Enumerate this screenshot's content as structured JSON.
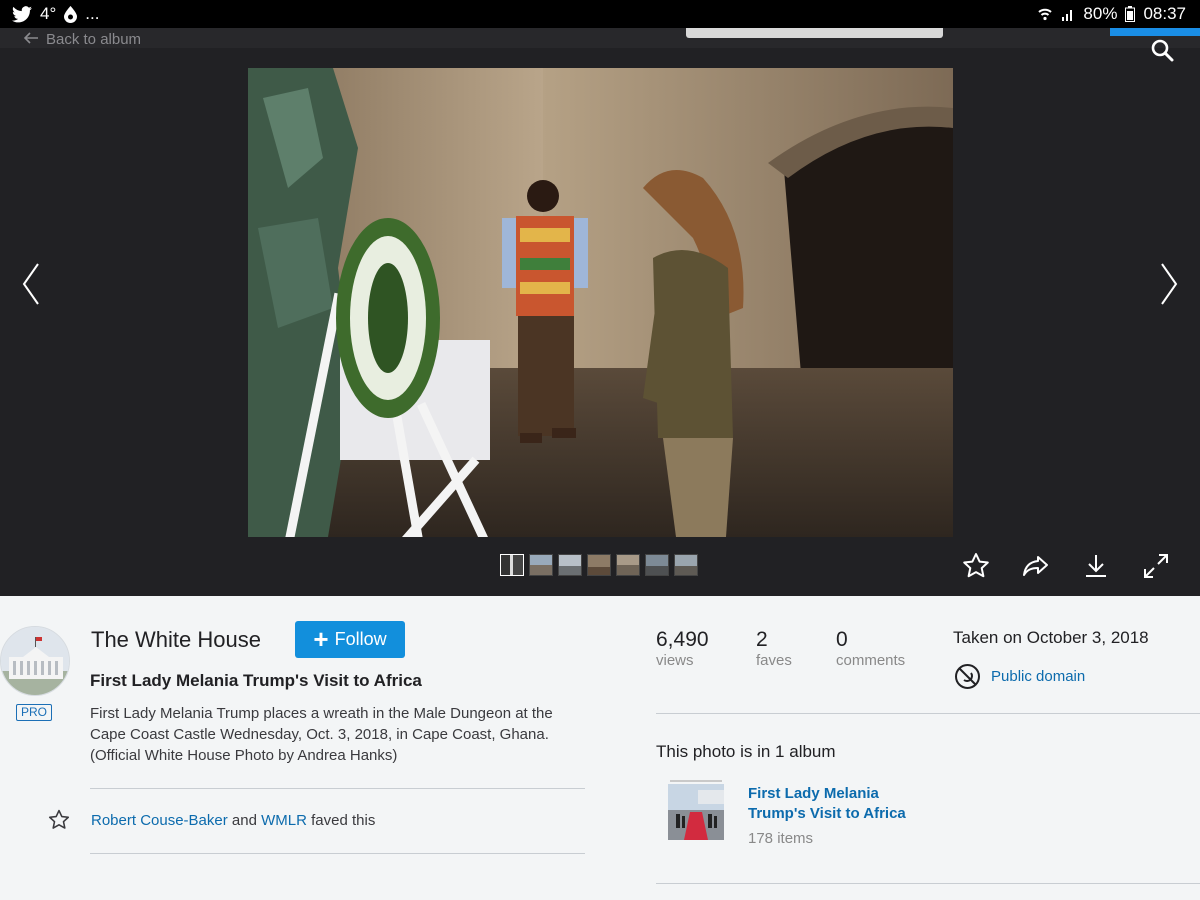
{
  "statusbar": {
    "temperature": "4°",
    "more": "...",
    "battery": "80%",
    "time": "08:37"
  },
  "viewer": {
    "back_label": "Back to album",
    "thumbnail_count": 7,
    "active_thumbnail": 1
  },
  "owner": {
    "name": "The White House",
    "badge": "PRO",
    "follow_label": "Follow"
  },
  "photo": {
    "title": "First Lady Melania Trump's Visit to Africa",
    "description": "First Lady Melania Trump places a wreath in the Male Dungeon at the Cape Coast Castle Wednesday, Oct. 3, 2018, in Cape Coast, Ghana. (Official White House Photo by Andrea Hanks)"
  },
  "faves_line": {
    "user1": "Robert Couse-Baker",
    "and": "and",
    "user2": "WMLR",
    "suffix": "faved this"
  },
  "stats": {
    "views": {
      "value": "6,490",
      "label": "views"
    },
    "faves": {
      "value": "2",
      "label": "faves"
    },
    "comments": {
      "value": "0",
      "label": "comments"
    }
  },
  "taken": "Taken on October 3, 2018",
  "license": "Public domain",
  "albums": {
    "heading": "This photo is in 1 album",
    "items": [
      {
        "name": "First Lady Melania Trump's Visit to Africa",
        "count": "178 items"
      }
    ]
  },
  "colors": {
    "accent": "#128fdc",
    "link": "#0c6bad",
    "viewer_bg": "#212124"
  }
}
